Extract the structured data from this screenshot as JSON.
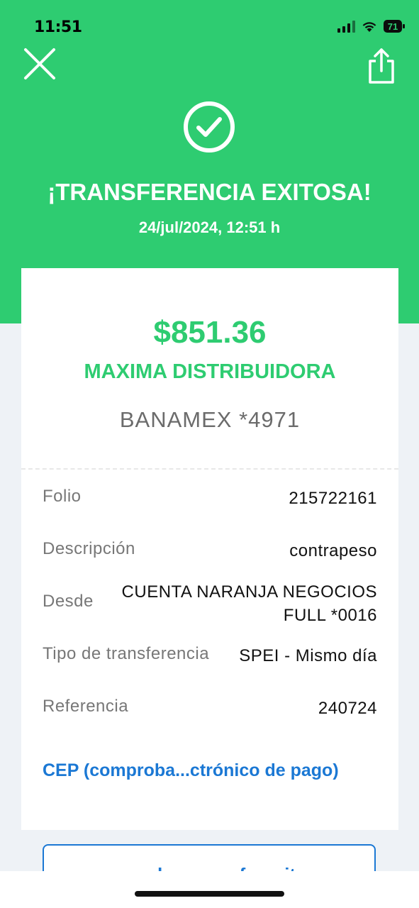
{
  "status_bar": {
    "time": "11:51",
    "battery": "71"
  },
  "header": {
    "close_icon": "close-x-icon",
    "share_icon": "share-icon",
    "success_icon": "check-circle-icon",
    "title": "¡TRANSFERENCIA EXITOSA!",
    "datetime": "24/jul/2024, 12:51 h"
  },
  "receipt": {
    "amount": "$851.36",
    "beneficiary": "MAXIMA DISTRIBUIDORA",
    "account": "BANAMEX *4971",
    "details": [
      {
        "label": "Folio",
        "value": "215722161"
      },
      {
        "label": "Descripción",
        "value": "contrapeso"
      },
      {
        "label": "Desde",
        "value_line1": "CUENTA NARANJA NEGOCIOS",
        "value_line2": "FULL *0016"
      },
      {
        "label": "Tipo de transferencia",
        "value": "SPEI - Mismo día"
      },
      {
        "label": "Referencia",
        "value": "240724"
      }
    ],
    "cep_link": "CEP (comproba...ctrónico de pago)"
  },
  "actions": {
    "favorite_button": "guardar como favorito"
  },
  "colors": {
    "accent_green": "#2ecc71",
    "link_blue": "#1b78d4",
    "background": "#eef2f6"
  }
}
